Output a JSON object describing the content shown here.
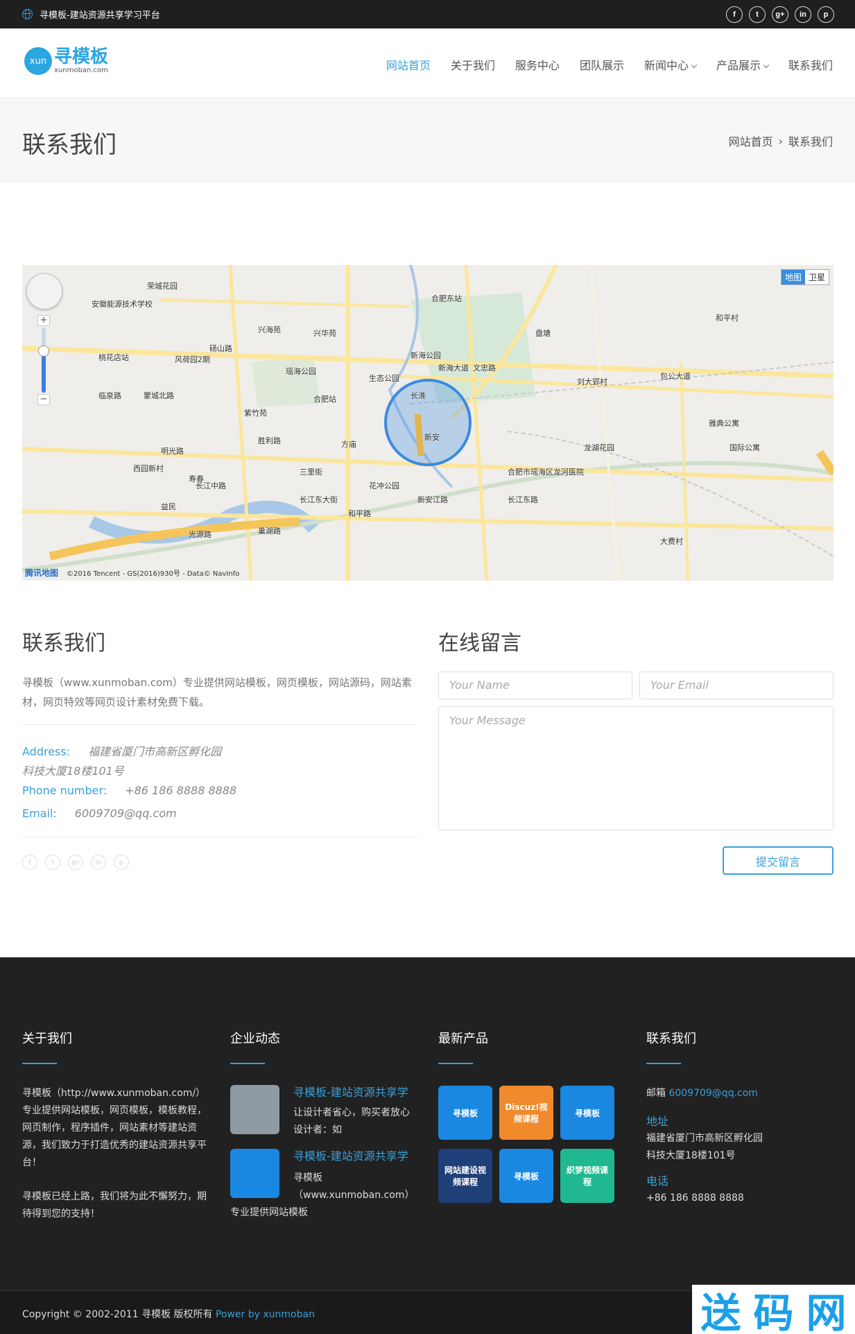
{
  "topbar": {
    "slogan": "寻模板-建站资源共享学习平台",
    "social": [
      {
        "icon": "facebook-icon",
        "glyph": "f"
      },
      {
        "icon": "twitter-icon",
        "glyph": "t"
      },
      {
        "icon": "google-plus-icon",
        "glyph": "g+"
      },
      {
        "icon": "linkedin-icon",
        "glyph": "in"
      },
      {
        "icon": "pinterest-icon",
        "glyph": "p"
      }
    ]
  },
  "logo": {
    "badge": "xun",
    "name": "寻模板",
    "domain": "xunmoban.com"
  },
  "nav": {
    "items": [
      "网站首页",
      "关于我们",
      "服务中心",
      "团队展示",
      "新闻中心",
      "产品展示",
      "联系我们"
    ],
    "active": "网站首页"
  },
  "page": {
    "title": "联系我们",
    "breadcrumb": [
      "网站首页",
      "联系我们"
    ]
  },
  "map": {
    "toggle": [
      "地图",
      "卫星"
    ],
    "copyright": "©2016 Tencent - GS(2016)930号 - Data© NavInfo",
    "brand": "腾讯地图",
    "labels": [
      "荣城花园",
      "安徽能源技术学校",
      "兴海苑",
      "兴华苑",
      "合肥东站",
      "桃花店站",
      "风荷园2期",
      "砀山路",
      "瑶海公园",
      "新海公园",
      "新海大道",
      "盘塘",
      "包公大道",
      "和平村",
      "临泉路",
      "合肥站",
      "生态公园",
      "文忠路",
      "刘大郢村",
      "紫竹苑",
      "长淮",
      "胜利路",
      "明光路",
      "西园新村",
      "方庙",
      "新安",
      "龙湖花园",
      "雅典公寓",
      "国际公寓",
      "长江中路",
      "益民",
      "寿春",
      "三里街",
      "花冲公园",
      "合肥市瑶海区龙河医院",
      "长江东路",
      "新安江路",
      "大费村",
      "和平路",
      "光源路",
      "巢湖路",
      "长江东大街",
      "蒙城北路"
    ]
  },
  "contact": {
    "heading": "联系我们",
    "intro": "寻模板（www.xunmoban.com）专业提供网站模板，网页模板，网站源码，网站素材，网页特效等网页设计素材免费下载。",
    "address_label": "Address:",
    "address": "福建省厦门市高新区孵化园",
    "address2": "科技大厦18楼101号",
    "phone_label": "Phone number:",
    "phone": "+86 186 8888 8888",
    "email_label": "Email:",
    "email": "6009709@qq.com"
  },
  "form": {
    "heading": "在线留言",
    "name_ph": "Your Name",
    "email_ph": "Your Email",
    "message_ph": "Your Message",
    "submit": "提交留言"
  },
  "footer": {
    "about": {
      "title": "关于我们",
      "p1": "寻模板（http://www.xunmoban.com/）专业提供网站模板，网页模板，模板教程，网页制作，程序插件，网站素材等建站资源，我们致力于打造优秀的建站资源共享平台！",
      "p2": "寻模板已经上路，我们将为此不懈努力，期待得到您的支持！"
    },
    "news": {
      "title": "企业动态",
      "items": [
        {
          "title": "寻模板-建站资源共享学",
          "desc1": "让设计者省心，购买者放心",
          "desc2": "设计者：如"
        },
        {
          "title": "寻模板-建站资源共享学",
          "desc1": "寻模板",
          "desc2": "（www.xunmoban.com）",
          "desc3": "专业提供网站模板"
        }
      ]
    },
    "products": {
      "title": "最新产品",
      "items": [
        {
          "label": "寻模板",
          "color": "#1a88e0"
        },
        {
          "label": "Discuz!视频课程",
          "color": "#f08a2c"
        },
        {
          "label": "寻模板",
          "color": "#1a88e0"
        },
        {
          "label": "网站建设视频课程",
          "color": "#1e3f78"
        },
        {
          "label": "寻模板",
          "color": "#1a88e0"
        },
        {
          "label": "织梦视频课程",
          "color": "#20b890"
        }
      ]
    },
    "contact": {
      "title": "联系我们",
      "mail_label": "邮箱",
      "mail": "6009709@qq.com",
      "addr_label": "地址",
      "addr1": "福建省厦门市高新区孵化园",
      "addr2": "科技大厦18楼101号",
      "tel_label": "电话",
      "tel": "+86 186 8888 8888"
    }
  },
  "copyright": {
    "text": "Copyright © 2002-2011 寻模板 版权所有 ",
    "link": "Power by xunmoban"
  },
  "watermark": {
    "chars": [
      "送",
      "码",
      "网"
    ]
  },
  "colors": {
    "accent": "#3aa0d8",
    "dark": "#212121"
  }
}
